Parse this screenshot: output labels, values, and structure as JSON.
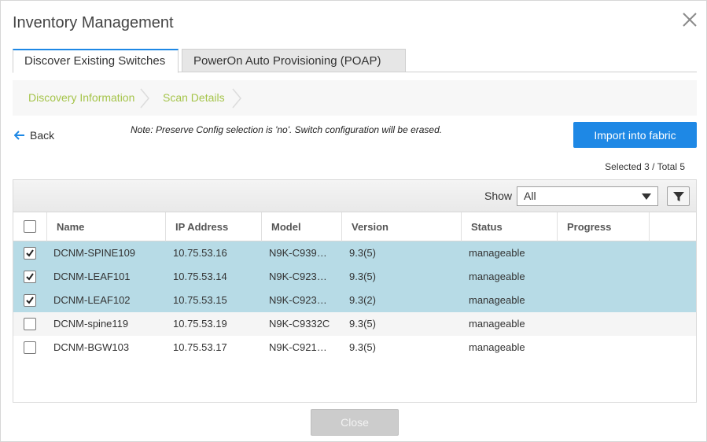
{
  "dialog": {
    "title": "Inventory Management",
    "close_icon": "close-icon"
  },
  "tabs": [
    {
      "label": "Discover Existing Switches",
      "active": true
    },
    {
      "label": "PowerOn Auto Provisioning (POAP)",
      "active": false
    }
  ],
  "steps": [
    {
      "label": "Discovery Information"
    },
    {
      "label": "Scan Details"
    }
  ],
  "back": {
    "label": "Back",
    "icon": "arrow-left-icon"
  },
  "note": "Note: Preserve Config selection is 'no'. Switch configuration will be erased.",
  "import_button": "Import into fabric",
  "selection_summary": "Selected 3 / Total 5",
  "toolbar": {
    "show_label": "Show",
    "show_value": "All",
    "filter_icon": "filter-icon"
  },
  "table": {
    "columns": [
      "Name",
      "IP Address",
      "Model",
      "Version",
      "Status",
      "Progress"
    ],
    "rows": [
      {
        "checked": true,
        "name": "DCNM-SPINE109",
        "ip": "10.75.53.16",
        "model": "N9K-C939…",
        "version": "9.3(5)",
        "status": "manageable",
        "progress": ""
      },
      {
        "checked": true,
        "name": "DCNM-LEAF101",
        "ip": "10.75.53.14",
        "model": "N9K-C923…",
        "version": "9.3(5)",
        "status": "manageable",
        "progress": ""
      },
      {
        "checked": true,
        "name": "DCNM-LEAF102",
        "ip": "10.75.53.15",
        "model": "N9K-C923…",
        "version": "9.3(2)",
        "status": "manageable",
        "progress": ""
      },
      {
        "checked": false,
        "name": "DCNM-spine119",
        "ip": "10.75.53.19",
        "model": "N9K-C9332C",
        "version": "9.3(5)",
        "status": "manageable",
        "progress": ""
      },
      {
        "checked": false,
        "name": "DCNM-BGW103",
        "ip": "10.75.53.17",
        "model": "N9K-C921…",
        "version": "9.3(5)",
        "status": "manageable",
        "progress": ""
      }
    ]
  },
  "close_button": "Close",
  "colors": {
    "accent": "#1e88e5",
    "step_text": "#a5c44a",
    "selected_row": "#b7dbe6"
  }
}
